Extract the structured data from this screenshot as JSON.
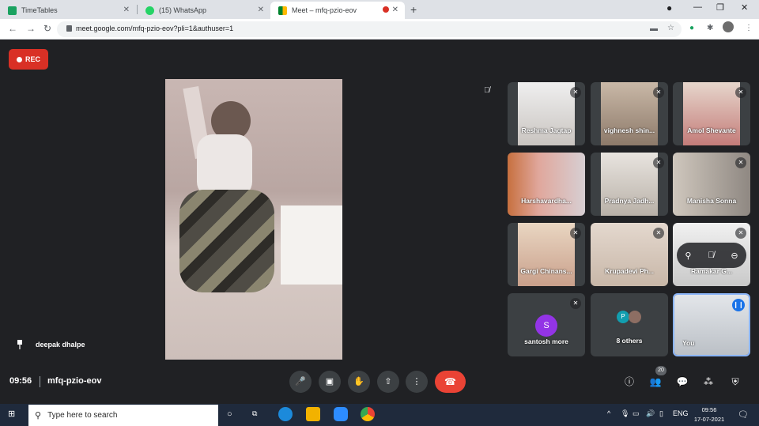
{
  "browser": {
    "tabs": [
      {
        "title": "TimeTables",
        "favicon_color": "#1aa260"
      },
      {
        "title": "(15) WhatsApp",
        "favicon_color": "#25d366"
      },
      {
        "title": "Meet – mfq-pzio-eov",
        "favicon_color": "#00832d"
      }
    ],
    "url": "meet.google.com/mfq-pzio-eov?pli=1&authuser=1"
  },
  "meet": {
    "rec_label": "REC",
    "speaker_name": "deepak dhalpe",
    "time": "09:56",
    "meeting_code": "mfq-pzio-eov",
    "participant_count": "20",
    "tiles": [
      {
        "name": "Reshma Jagtap"
      },
      {
        "name": "vighnesh shin..."
      },
      {
        "name": "Amol Shevante"
      },
      {
        "name": "Harshavardha..."
      },
      {
        "name": "Pradnya Jadh..."
      },
      {
        "name": "Manisha Sonna"
      },
      {
        "name": "Gargi Chinans..."
      },
      {
        "name": "Krupadevi Ph..."
      },
      {
        "name": "Ramakar G..."
      },
      {
        "name": "santosh more",
        "initial": "S"
      },
      {
        "name": "8 others",
        "initial": "P"
      },
      {
        "name": "You"
      }
    ]
  },
  "taskbar": {
    "search_placeholder": "Type here to search",
    "lang": "ENG",
    "clock_time": "09:56",
    "clock_date": "17-07-2021"
  }
}
